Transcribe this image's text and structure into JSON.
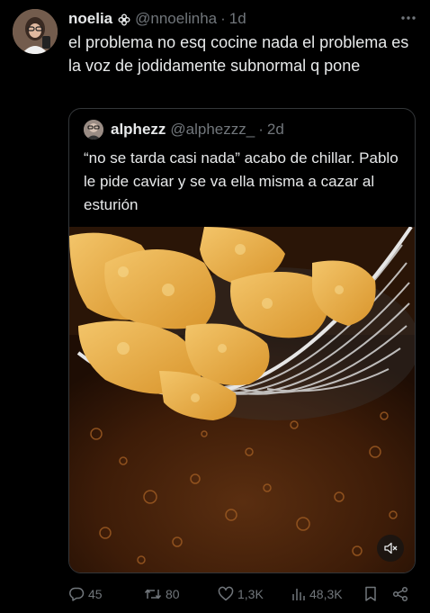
{
  "tweet": {
    "display_name": "noelia",
    "handle": "@nnoelinha",
    "separator": "·",
    "time": "1d",
    "more_icon": "more-icon",
    "text": "el problema no esq cocine nada el problema es la voz de jodidamente subnormal q pone"
  },
  "quote": {
    "display_name": "alphezz",
    "handle": "@alphezzz_",
    "separator": "·",
    "time": "2d",
    "text": "“no se tarda casi nada” acabo de chillar. Pablo le pide caviar y se va ella misma a cazar al esturión",
    "media_icon": "mute-icon"
  },
  "actions": {
    "replies": "45",
    "reposts": "80",
    "likes": "1,3K",
    "views": "48,3K"
  },
  "colors": {
    "background": "#000000",
    "text": "#e7e9ea",
    "muted": "#71767b",
    "border": "#333639"
  }
}
